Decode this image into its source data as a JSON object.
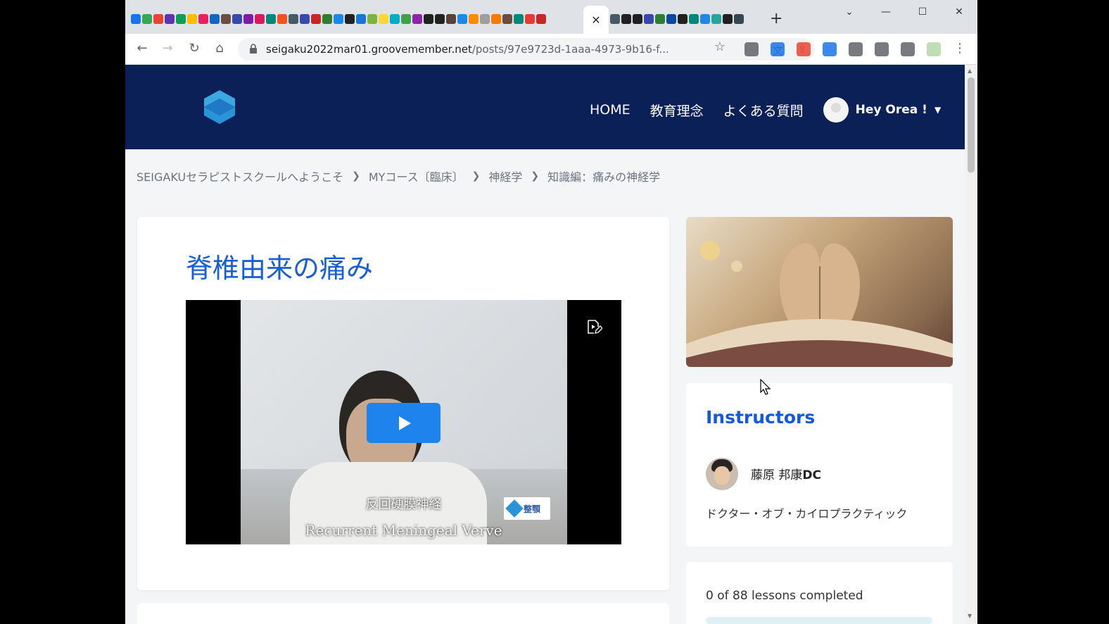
{
  "browser": {
    "new_tab_symbol": "+",
    "active_tab_close": "✕",
    "window_controls": {
      "dropdown": "⌄",
      "minimize": "—",
      "maximize": "☐",
      "close": "✕"
    },
    "url_host": "seigaku2022mar01.groovemember.net",
    "url_path": "/posts/97e9723d-1aaa-4973-9b16-f...",
    "tab_favicon_colors": [
      "#1a73e8",
      "#34a853",
      "#ea4335",
      "#5e35b1",
      "#0f9d58",
      "#fbbc04",
      "#e91e63",
      "#1565c0",
      "#6d4c41",
      "#3949ab",
      "#7b1fa2",
      "#d81b60",
      "#00897b",
      "#f4511e",
      "#455a64",
      "#3949ab",
      "#c62828",
      "#2e7d32",
      "#1e88e5",
      "#212121",
      "#1976d2",
      "#7cb342",
      "#fdd835",
      "#00acc1",
      "#43a047",
      "#8e24aa",
      "#212121",
      "#212121",
      "#5d4037",
      "#1e88e5",
      "#fb8c00",
      "#9e9e9e",
      "#f57c00",
      "#6d4c41",
      "#00897b",
      "#e53935",
      "#c62828"
    ],
    "tab_favicon_colors_2": [
      "#455a64",
      "#212121",
      "#212121",
      "#3949ab",
      "#2e7d32",
      "#0d47a1",
      "#212121",
      "#00897b",
      "#1e88e5",
      "#26a69a",
      "#212121",
      "#37474f"
    ],
    "extension_colors": [
      "#5f6368",
      "#1a73e8",
      "#ea4335",
      "#1a73e8",
      "#5f6368",
      "#5f6368",
      "#5f6368",
      "#b6d7a8"
    ]
  },
  "header": {
    "nav": [
      "HOME",
      "教育理念",
      "よくある質問"
    ],
    "user_greeting": "Hey Orea !"
  },
  "breadcrumb": [
    "SEIGAKUセラピストスクールへようこそ",
    "MYコース〔臨床〕",
    "神経学",
    "知識編：痛みの神経学"
  ],
  "lesson": {
    "title": "脊椎由来の痛み",
    "video_subtitle_jp": "反回硬膜神経",
    "video_subtitle_en": "Recurrent Meningeal Verve",
    "video_logo_text": "整顎"
  },
  "sidebar": {
    "instructors_heading": "Instructors",
    "instructor_name": "藤原 邦康",
    "instructor_suffix": "DC",
    "instructor_title": "ドクター・オブ・カイロプラクティック",
    "progress_text": "0 of 88 lessons completed",
    "progress_fraction": 0
  },
  "colors": {
    "header_bg": "#0b2057",
    "title_blue": "#1a5fd0",
    "accent_blue": "#1559d6",
    "play_button": "#1f83ee"
  }
}
